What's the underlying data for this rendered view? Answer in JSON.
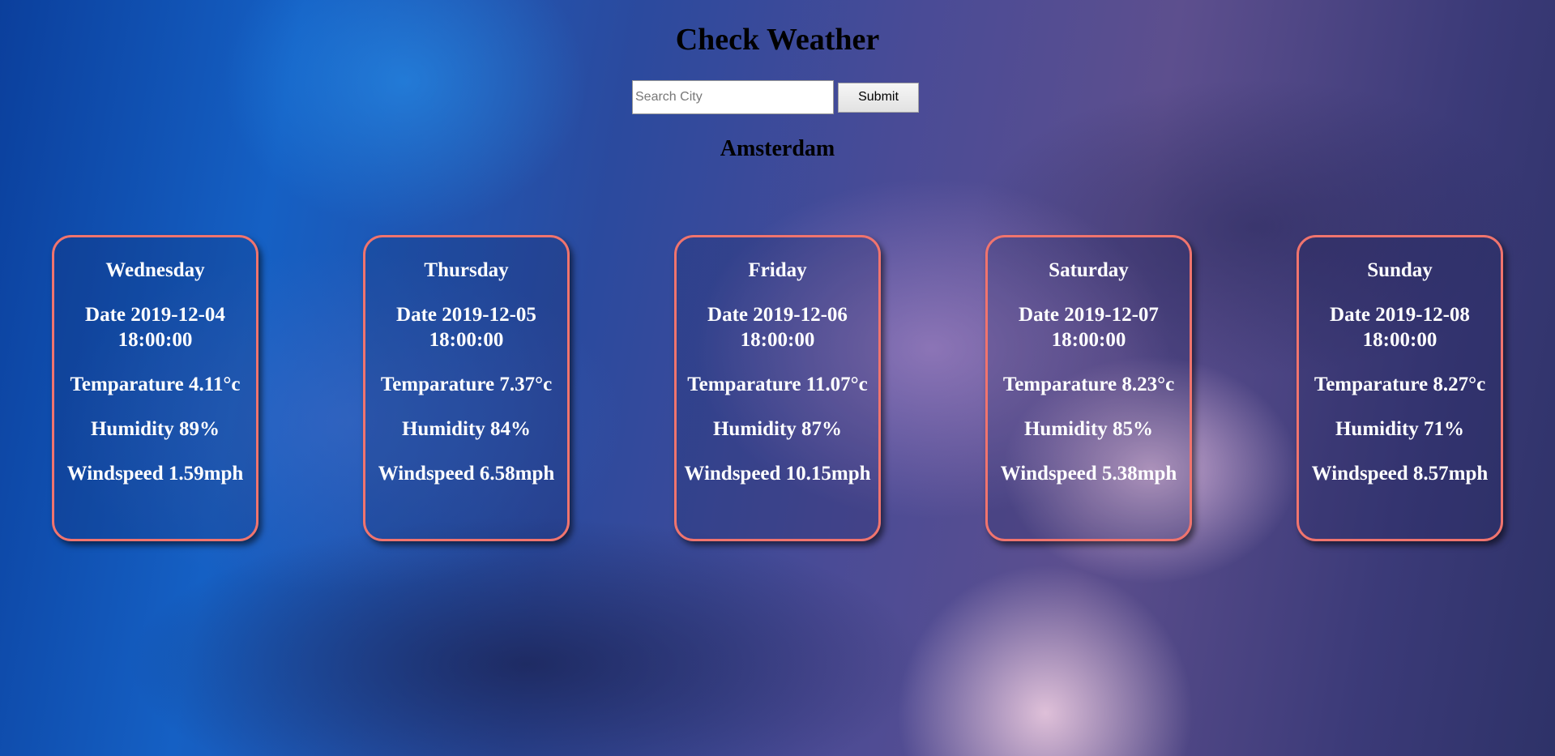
{
  "header": {
    "title": "Check Weather"
  },
  "search": {
    "placeholder": "Search City",
    "value": "",
    "submit_label": "Submit"
  },
  "city": "Amsterdam",
  "forecast": [
    {
      "day": "Wednesday",
      "date": "Date 2019-12-04 18:00:00",
      "temperature": "Temparature 4.11°c",
      "humidity": "Humidity 89%",
      "windspeed": "Windspeed 1.59mph"
    },
    {
      "day": "Thursday",
      "date": "Date 2019-12-05 18:00:00",
      "temperature": "Temparature 7.37°c",
      "humidity": "Humidity 84%",
      "windspeed": "Windspeed 6.58mph"
    },
    {
      "day": "Friday",
      "date": "Date 2019-12-06 18:00:00",
      "temperature": "Temparature 11.07°c",
      "humidity": "Humidity 87%",
      "windspeed": "Windspeed 10.15mph"
    },
    {
      "day": "Saturday",
      "date": "Date 2019-12-07 18:00:00",
      "temperature": "Temparature 8.23°c",
      "humidity": "Humidity 85%",
      "windspeed": "Windspeed 5.38mph"
    },
    {
      "day": "Sunday",
      "date": "Date 2019-12-08 18:00:00",
      "temperature": "Temparature 8.27°c",
      "humidity": "Humidity 71%",
      "windspeed": "Windspeed 8.57mph"
    }
  ],
  "colors": {
    "card_border": "#f0746e",
    "card_text": "#ffffff",
    "title_text": "#000000"
  }
}
